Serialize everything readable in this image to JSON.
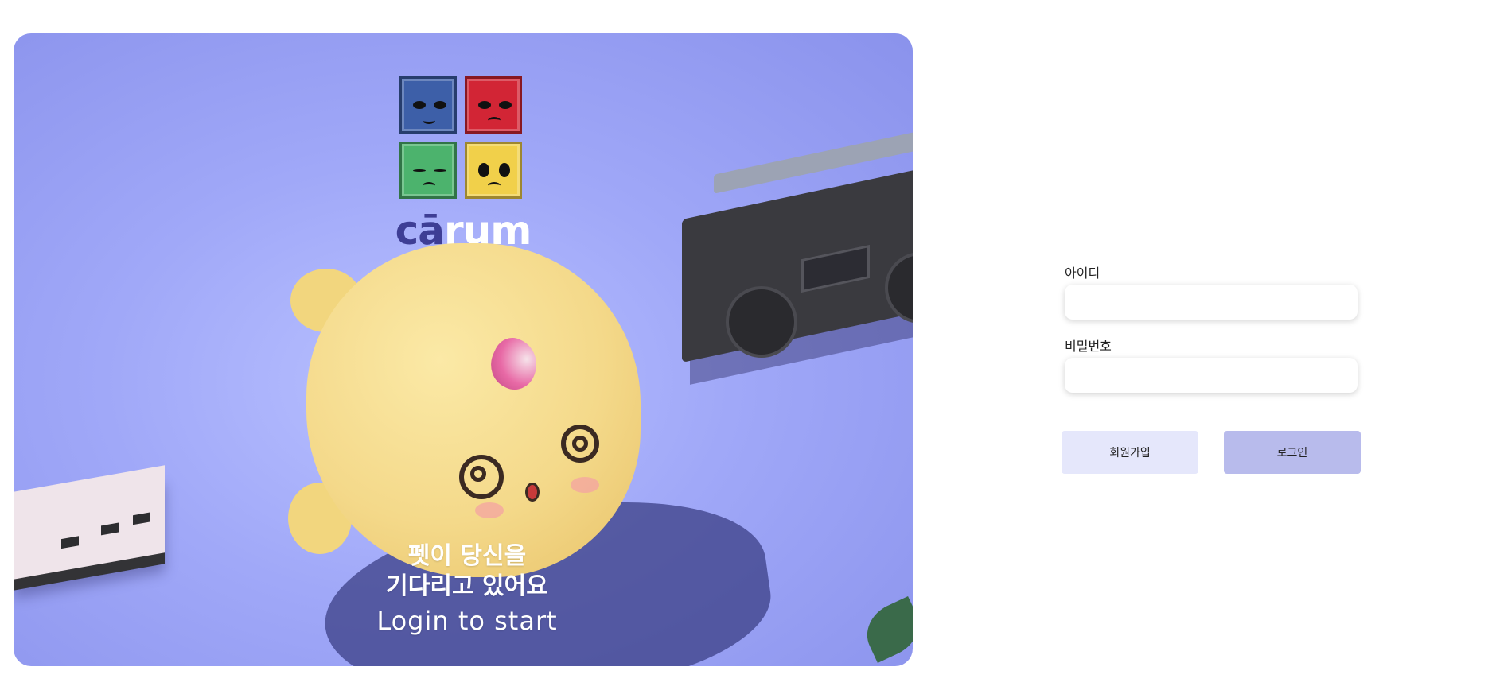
{
  "hero": {
    "brand_prefix": "cā",
    "brand_suffix": "rum",
    "message_line1": "펫이 당신을",
    "message_line2": "기다리고 있어요",
    "message_line3": "Login to start",
    "background_color": "#a0a8f8"
  },
  "login_form": {
    "id_label": "아이디",
    "id_value": "",
    "password_label": "비밀번호",
    "password_value": "",
    "signup_button": "회원가입",
    "login_button": "로그인",
    "signup_color": "#e5e7fb",
    "login_color": "#b8bbec"
  }
}
